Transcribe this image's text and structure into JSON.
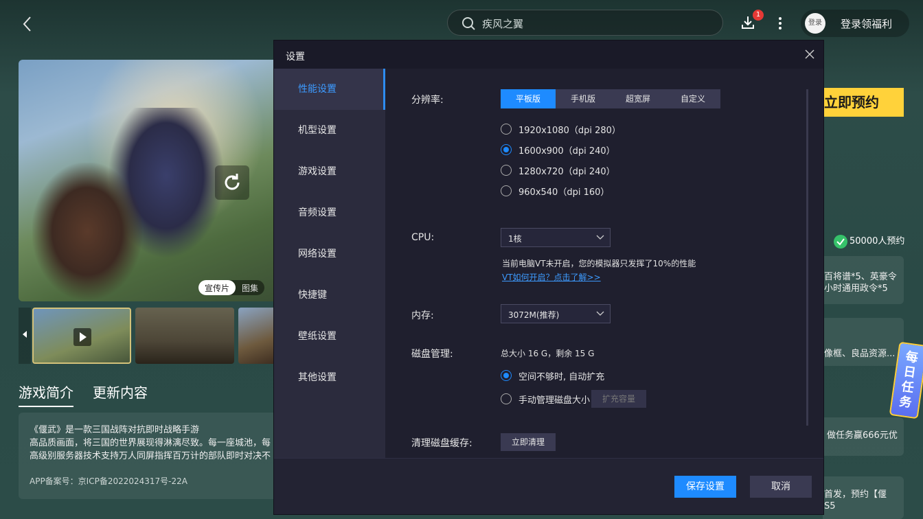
{
  "page": {
    "search_text": "疾风之翼",
    "download_badge": "1",
    "avatar_text": "登录",
    "login_label": "登录领福利",
    "hero_tabs": [
      "宣传片",
      "图集"
    ],
    "intro_tabs": [
      "游戏简介",
      "更新内容"
    ],
    "intro_lines": [
      "《偃武》是一款三国战阵对抗即时战略手游",
      "高品质画面，将三国的世界展现得淋漓尽致。每一座城池，每",
      "高级别服务器技术支持万人同屏指挥百万计的部队即时对决不"
    ],
    "icp": "APP备案号：京ICP备2022024317号-22A",
    "reserve_button": "立即预约",
    "reserve_count": "50000人预约",
    "cards": [
      "百将谱*5、英豪令\n小时通用政令*5",
      "像框、良品资源...",
      "做任务赢666元优",
      "首发，预约【偃\nS5"
    ],
    "daily_badge": "每日任务"
  },
  "modal": {
    "title": "设置",
    "sidebar": [
      {
        "label": "性能设置",
        "active": true
      },
      {
        "label": "机型设置"
      },
      {
        "label": "游戏设置"
      },
      {
        "label": "音频设置"
      },
      {
        "label": "网络设置"
      },
      {
        "label": "快捷键"
      },
      {
        "label": "壁纸设置"
      },
      {
        "label": "其他设置"
      }
    ],
    "resolution": {
      "label": "分辨率:",
      "tabs": [
        "平板版",
        "手机版",
        "超宽屏",
        "自定义"
      ],
      "active_tab": "平板版",
      "options": [
        "1920x1080（dpi 280）",
        "1600x900（dpi 240）",
        "1280x720（dpi 240）",
        "960x540（dpi 160）"
      ],
      "selected": "1600x900（dpi 240）"
    },
    "cpu": {
      "label": "CPU:",
      "value": "1核",
      "hint": "当前电脑VT未开启，您的模拟器只发挥了10%的性能",
      "link": "VT如何开启？点击了解>>"
    },
    "memory": {
      "label": "内存:",
      "value": "3072M(推荐)"
    },
    "disk": {
      "label": "磁盘管理:",
      "info": "总大小 16 G，剩余 15 G",
      "option_auto": "空间不够时, 自动扩充",
      "option_manual": "手动管理磁盘大小",
      "expand_button": "扩充容量"
    },
    "clean": {
      "label": "清理磁盘缓存:",
      "button": "立即清理"
    },
    "footer": {
      "save": "保存设置",
      "cancel": "取消"
    }
  },
  "colors": {
    "accent": "#1e8bff",
    "reserve": "#ffd23a"
  }
}
